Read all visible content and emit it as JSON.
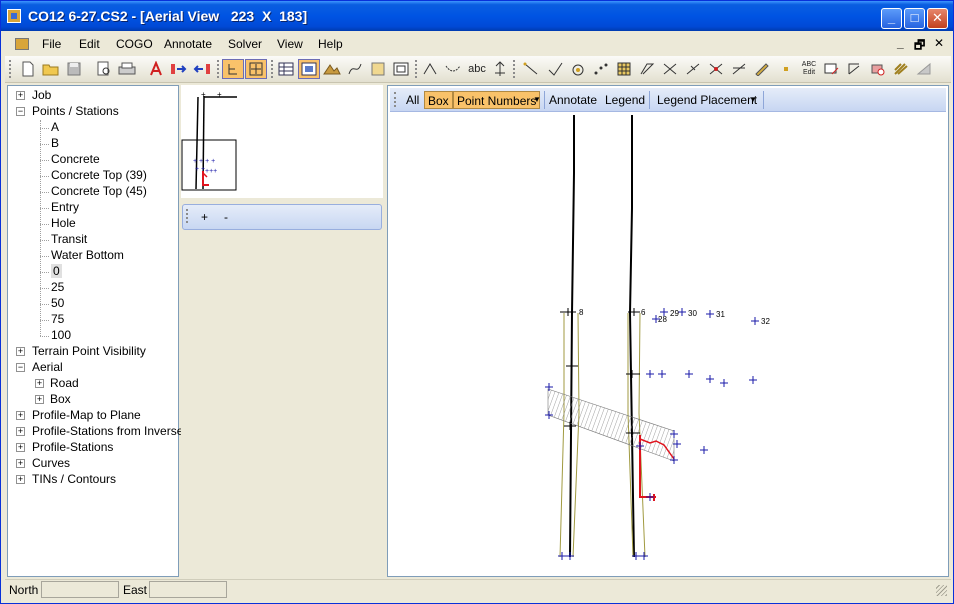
{
  "window": {
    "title": "CO12 6-27.CS2 - [Aerial View   223  X  183]",
    "controls": {
      "minimize": "_",
      "maximize": "□",
      "close": "✕"
    }
  },
  "menu": {
    "items": [
      "File",
      "Edit",
      "COGO",
      "Annotate",
      "Solver",
      "View",
      "Help"
    ],
    "mdi_controls": {
      "minimize": "_",
      "restore": "🗗",
      "close": "✕"
    }
  },
  "toolbar": {
    "icons": [
      "new-file-icon",
      "open-folder-icon",
      "save-icon",
      "print-preview-icon",
      "print-icon",
      "text-style-icon",
      "arrow-right-icon",
      "arrow-left-icon",
      "tree-view-icon",
      "zoom-fit-icon",
      "table-icon",
      "window-icon",
      "terrain-icon",
      "curve-icon",
      "panel-icon",
      "frame-icon",
      "line-icon",
      "arc-icon",
      "abc-text-icon",
      "north-arrow-icon",
      "segment-icon",
      "angle-icon",
      "circle-target-icon",
      "dots-icon",
      "grid-icon",
      "polyline-icon",
      "cross-icon",
      "diagonal-icon",
      "intersect-icon",
      "bisect-icon",
      "pen-icon",
      "dot-icon",
      "abc-edit-icon",
      "measure-icon",
      "bearing-icon",
      "eraser-icon",
      "hatch-icon",
      "triangle-icon"
    ],
    "abc_text": "abc",
    "abc_edit_top": "ABC",
    "abc_edit_bottom": "Edit"
  },
  "tree": {
    "nodes": [
      {
        "label": "Job",
        "expander": "+"
      },
      {
        "label": "Points / Stations",
        "expander": "−"
      },
      {
        "label": "A"
      },
      {
        "label": "B"
      },
      {
        "label": "Concrete"
      },
      {
        "label": "Concrete Top (39)"
      },
      {
        "label": "Concrete Top (45)"
      },
      {
        "label": "Entry"
      },
      {
        "label": "Hole"
      },
      {
        "label": "Transit"
      },
      {
        "label": "Water Bottom"
      },
      {
        "label": "0",
        "selected": true
      },
      {
        "label": "25"
      },
      {
        "label": "50"
      },
      {
        "label": "75"
      },
      {
        "label": "100"
      },
      {
        "label": "Terrain Point Visibility",
        "expander": "+"
      },
      {
        "label": "Aerial",
        "expander": "−"
      },
      {
        "label": "Road",
        "expander": "+"
      },
      {
        "label": "Box",
        "expander": "+"
      },
      {
        "label": "Profile-Map to Plane",
        "expander": "+"
      },
      {
        "label": "Profile-Stations from Inverse",
        "expander": "+"
      },
      {
        "label": "Profile-Stations",
        "expander": "+"
      },
      {
        "label": "Curves",
        "expander": "+"
      },
      {
        "label": "TINs / Contours",
        "expander": "+"
      }
    ]
  },
  "mini_toolbar": {
    "plus": "+",
    "minus": "-"
  },
  "view_toolbar": {
    "all": "All",
    "box": "Box",
    "point_numbers": "Point Numbers",
    "annotate": "Annotate",
    "legend": "Legend",
    "legend_placement": "Legend Placement",
    "caret": "▼"
  },
  "canvas_labels": [
    "8",
    "6",
    "28",
    "29",
    "30",
    "31",
    "32"
  ],
  "status": {
    "north_label": "North",
    "north_value": "",
    "east_label": "East",
    "east_value": ""
  },
  "colors": {
    "title_blue": "#0054e3",
    "point_blue": "#1a1aa8",
    "red": "#e0141e",
    "olive": "#a09a40"
  }
}
